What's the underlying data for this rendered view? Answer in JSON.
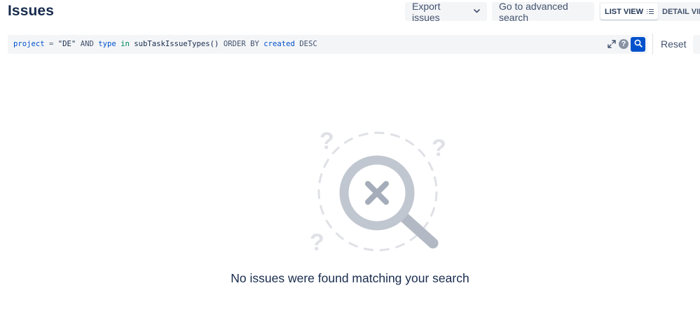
{
  "page": {
    "title": "Issues"
  },
  "toolbar": {
    "export_label": "Export issues",
    "advanced_label": "Go to advanced search",
    "list_view_label": "LIST VIEW",
    "detail_view_label": "DETAIL VIEW"
  },
  "search": {
    "query_tokens": {
      "t1": "project",
      "t2": " = ",
      "t3": "\"DE\"",
      "t4": " AND ",
      "t5": "type",
      "t6": " ",
      "t7": "in",
      "t8": " subTaskIssueTypes() ",
      "t9": "ORDER BY",
      "t10": " ",
      "t11": "created",
      "t12": " DESC"
    },
    "reset_label": "Reset",
    "help_glyph": "?"
  },
  "empty_state": {
    "message": "No issues were found matching your search"
  },
  "colors": {
    "accent": "#0052cc",
    "text": "#172b4d",
    "muted": "#42526e",
    "surface": "#f4f5f7"
  },
  "icons": {
    "export_chevron": "chevron-down-icon",
    "list_view": "list-icon",
    "expand": "expand-icon",
    "help": "help-icon",
    "search": "search-icon",
    "empty": "magnifier-x-icon"
  }
}
